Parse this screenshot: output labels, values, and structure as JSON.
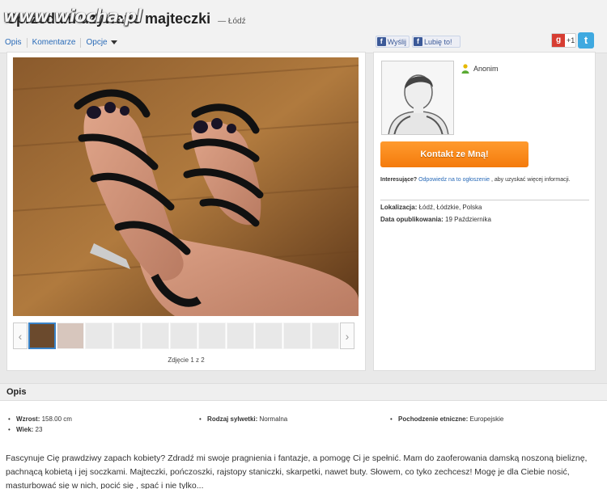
{
  "header": {
    "title": "Sprzedam używane majteczki",
    "city": "— Łódź",
    "watermark": "www.wiocha.pl"
  },
  "tabs": [
    "Opis",
    "Komentarze",
    "Opcje"
  ],
  "social": {
    "fb_send": "Wyślij",
    "fb_like": "Lubię to!",
    "gplus": "+1",
    "twitter_icon": "twitter-icon"
  },
  "gallery": {
    "caption": "Zdjęcie 1 z 2",
    "prev_icon": "chevron-left-icon",
    "next_icon": "chevron-right-icon"
  },
  "profile": {
    "username": "Anonim",
    "contact_button": "Kontakt ze Mną!",
    "interest_label": "Interesujące?",
    "interest_link": "Odpowiedz na to ogłoszenie",
    "interest_rest": ", aby uzyskać więcej informacji.",
    "location_label": "Lokalizacja:",
    "location_value": "Łódź, Łódzkie, Polska",
    "published_label": "Data opublikowania:",
    "published_value": "19 Października"
  },
  "description": {
    "heading": "Opis",
    "height_label": "Wzrost:",
    "height_value": "158.00 cm",
    "age_label": "Wiek:",
    "age_value": "23",
    "body_label": "Rodzaj sylwetki:",
    "body_value": "Normalna",
    "ethnic_label": "Pochodzenie etniczne:",
    "ethnic_value": "Europejskie",
    "text": "Fascynuje Cię prawdziwy zapach kobiety? Zdradź mi swoje pragnienia i fantazje, a pomogę Ci je spełnić. Mam do zaoferowania damską noszoną bieliznę, pachnącą kobietą i jej soczkami. Majteczki, pończoszki, rajstopy staniczki, skarpetki, nawet buty. Słowem, co tyko zechcesz! Mogę je dla Ciebie nosić, masturbować się w nich, pocić się , spać i nie tylko..."
  },
  "colors": {
    "accent_orange": "#f47b0c",
    "link_blue": "#2a6bb8",
    "facebook_blue": "#3b5998"
  }
}
